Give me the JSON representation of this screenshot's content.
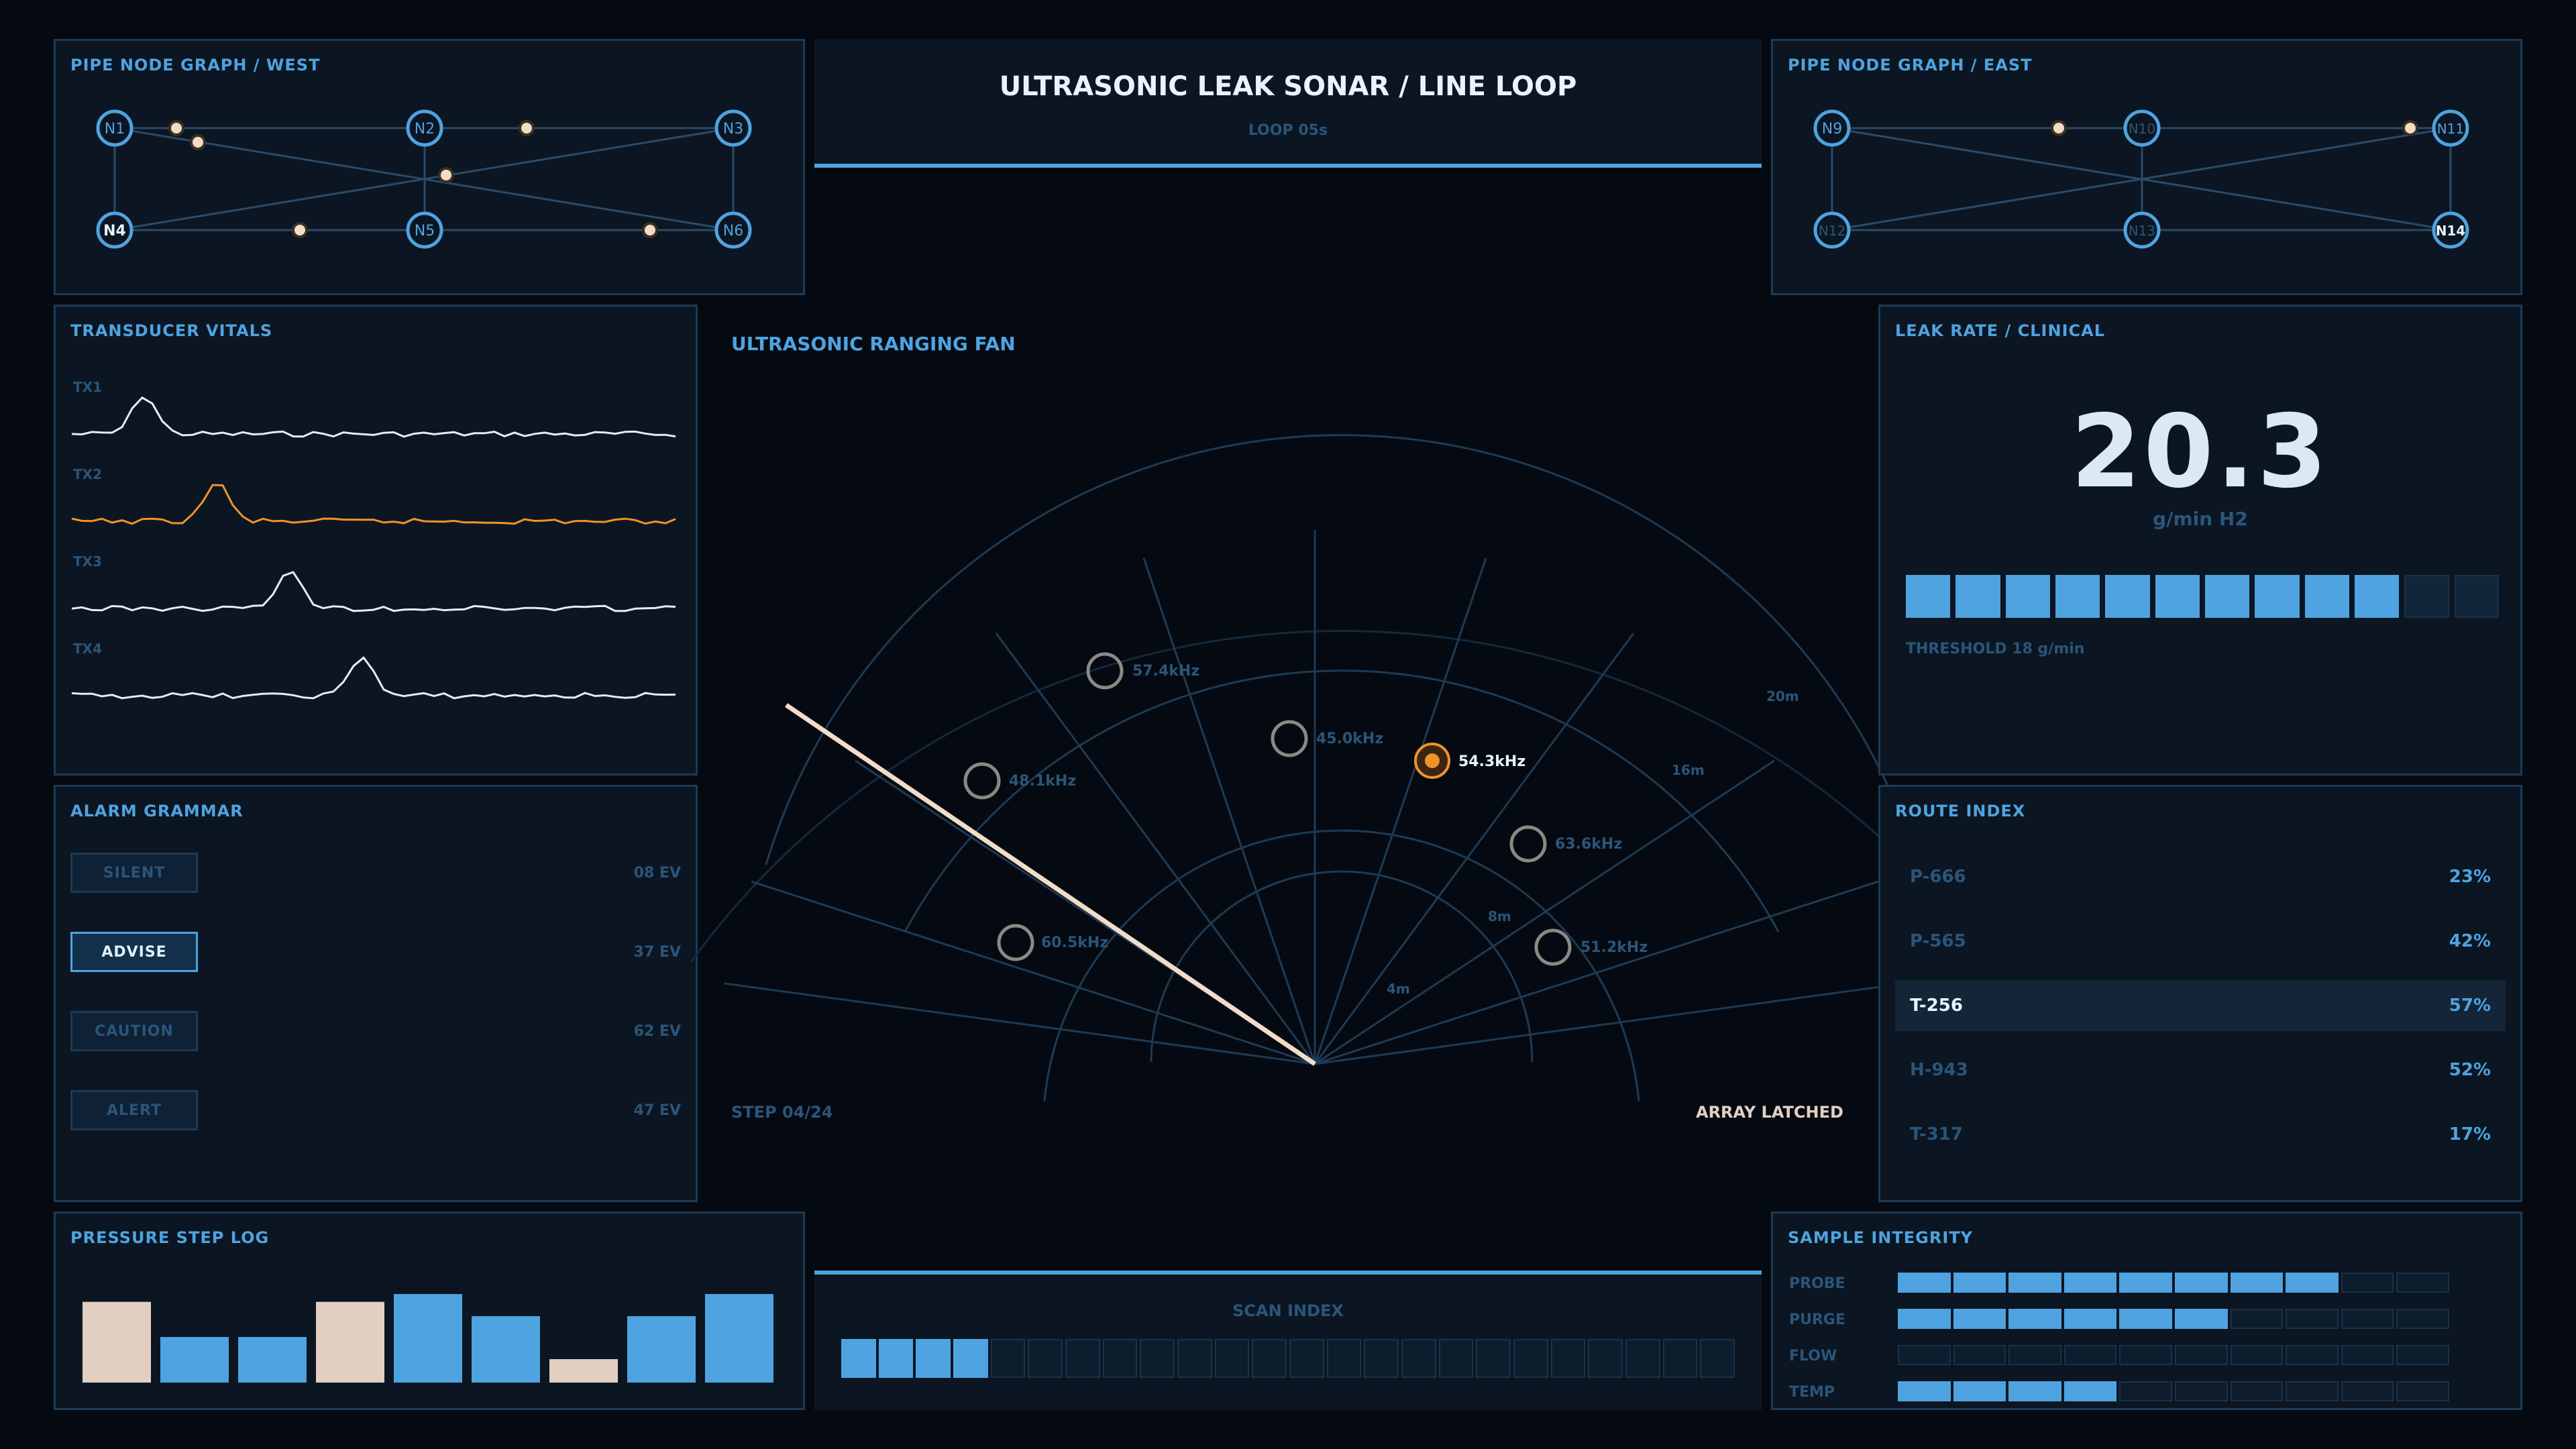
{
  "header": {
    "title": "ULTRASONIC LEAK SONAR / LINE LOOP",
    "subtitle": "LOOP 05s"
  },
  "graph_west": {
    "title": "PIPE NODE GRAPH / WEST",
    "nodes": [
      "N1",
      "N2",
      "N3",
      "N4",
      "N5",
      "N6"
    ]
  },
  "graph_east": {
    "title": "PIPE NODE GRAPH / EAST",
    "nodes": [
      "N9",
      "N10",
      "N11",
      "N12",
      "N13",
      "N14"
    ]
  },
  "vitals": {
    "title": "TRANSDUCER VITALS",
    "channels": [
      {
        "label": "TX1",
        "color": "#e6ecf2",
        "peak": 0.12
      },
      {
        "label": "TX2",
        "color": "#f0922b",
        "peak": 0.24
      },
      {
        "label": "TX3",
        "color": "#e6ecf2",
        "peak": 0.36
      },
      {
        "label": "TX4",
        "color": "#e6ecf2",
        "peak": 0.48
      }
    ]
  },
  "alarm": {
    "title": "ALARM GRAMMAR",
    "items": [
      {
        "label": "SILENT",
        "count": "08 EV",
        "active": false
      },
      {
        "label": "ADVISE",
        "count": "37 EV",
        "active": true
      },
      {
        "label": "CAUTION",
        "count": "62 EV",
        "active": false
      },
      {
        "label": "ALERT",
        "count": "47 EV",
        "active": false
      }
    ]
  },
  "fan": {
    "title": "ULTRASONIC RANGING FAN",
    "step": "STEP 04/24",
    "status": "ARRAY LATCHED",
    "ranges": [
      "4m",
      "8m",
      "16m",
      "20m"
    ],
    "contacts": [
      {
        "label": "57.4kHz",
        "active": false
      },
      {
        "label": "45.0kHz",
        "active": false
      },
      {
        "label": "54.3kHz",
        "active": true
      },
      {
        "label": "48.1kHz",
        "active": false
      },
      {
        "label": "63.6kHz",
        "active": false
      },
      {
        "label": "60.5kHz",
        "active": false
      },
      {
        "label": "51.2kHz",
        "active": false
      }
    ]
  },
  "leak": {
    "title": "LEAK RATE / CLINICAL",
    "value": "20.3",
    "unit": "g/min H2",
    "threshold": "THRESHOLD 18 g/min",
    "level_segments_filled": 10,
    "level_segments_total": 12
  },
  "routes": {
    "title": "ROUTE INDEX",
    "rows": [
      {
        "code": "P-666",
        "pct": "23%",
        "selected": false
      },
      {
        "code": "P-565",
        "pct": "42%",
        "selected": false
      },
      {
        "code": "T-256",
        "pct": "57%",
        "selected": true
      },
      {
        "code": "H-943",
        "pct": "52%",
        "selected": false
      },
      {
        "code": "T-317",
        "pct": "17%",
        "selected": false
      }
    ]
  },
  "pressure": {
    "title": "PRESSURE STEP LOG",
    "chart_data": {
      "type": "bar",
      "values": [
        0.62,
        0.35,
        0.35,
        0.62,
        0.68,
        0.51,
        0.18,
        0.51,
        0.68
      ],
      "highlight": [
        true,
        false,
        false,
        true,
        false,
        false,
        true,
        false,
        false
      ]
    }
  },
  "scan": {
    "title": "SCAN INDEX",
    "filled": 4,
    "total": 24
  },
  "integrity": {
    "title": "SAMPLE INTEGRITY",
    "rows": [
      {
        "label": "PROBE",
        "filled": 8,
        "total": 10
      },
      {
        "label": "PURGE",
        "filled": 6,
        "total": 10
      },
      {
        "label": "FLOW",
        "filled": 0,
        "total": 10
      },
      {
        "label": "TEMP",
        "filled": 4,
        "total": 10
      }
    ]
  },
  "colors": {
    "accent": "#4fa3e0",
    "warn": "#f0922b",
    "sand": "#e3cfc2",
    "bg": "#050a12",
    "panel": "#0b1622"
  }
}
